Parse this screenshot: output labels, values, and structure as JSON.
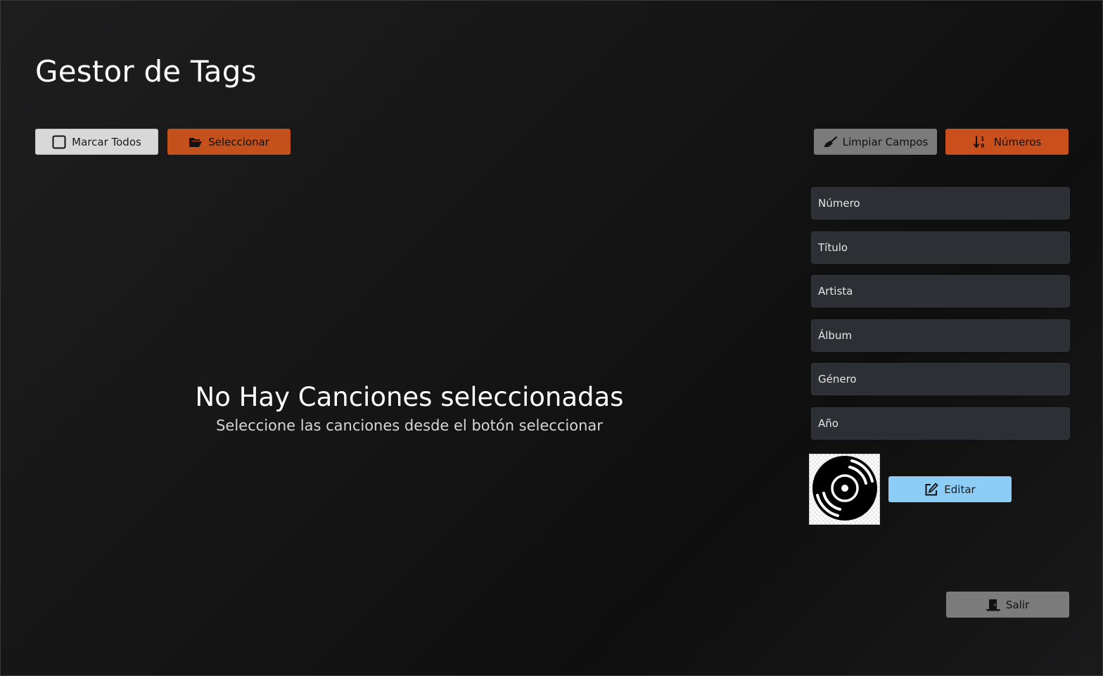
{
  "app": {
    "title": "Gestor de Tags"
  },
  "toolbar": {
    "mark_all_label": "Marcar Todos",
    "select_label": "Seleccionar",
    "clear_fields_label": "Limpiar Campos",
    "numbers_label": "Números"
  },
  "empty_state": {
    "title": "No Hay Canciones seleccionadas",
    "subtitle": "Seleccione las canciones desde el botón seleccionar"
  },
  "fields": {
    "number_placeholder": "Número",
    "title_placeholder": "Título",
    "artist_placeholder": "Artista",
    "album_placeholder": "Álbum",
    "genre_placeholder": "Género",
    "year_placeholder": "Año"
  },
  "cover": {
    "edit_label": "Editar",
    "icon": "vinyl-record-icon"
  },
  "footer": {
    "exit_label": "Salir"
  },
  "colors": {
    "accent_orange": "#c4501c",
    "accent_blue": "#8ccdf7",
    "button_grey": "#7b7b7b",
    "field_bg": "#2c2f33"
  }
}
